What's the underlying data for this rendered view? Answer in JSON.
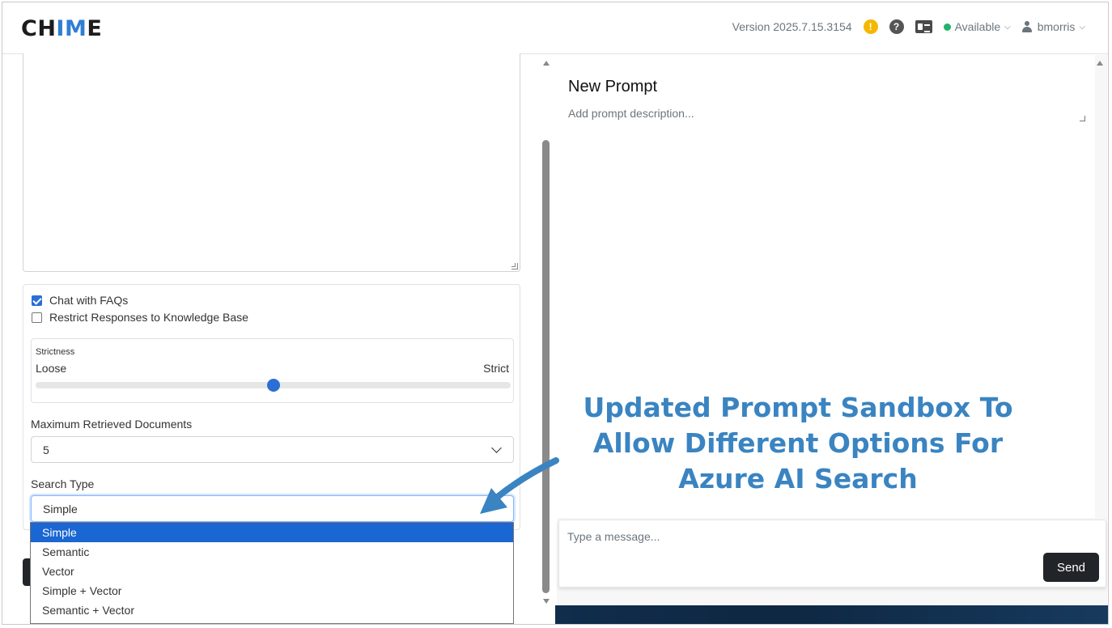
{
  "header": {
    "logo_prefix": "CH",
    "logo_highlight": "IM",
    "logo_suffix": "E",
    "version": "Version 2025.7.15.3154",
    "warning_icon": "!",
    "help_icon": "?",
    "status": "Available",
    "user": "bmorris"
  },
  "options": {
    "chat_faqs": {
      "label": "Chat with FAQs",
      "checked": true
    },
    "restrict": {
      "label": "Restrict Responses to Knowledge Base",
      "checked": false
    },
    "strictness": {
      "title": "Strictness",
      "min_label": "Loose",
      "max_label": "Strict",
      "value": 0.5
    },
    "max_docs": {
      "label": "Maximum Retrieved Documents",
      "value": "5"
    },
    "search_type": {
      "label": "Search Type",
      "value": "Simple",
      "options": [
        "Simple",
        "Semantic",
        "Vector",
        "Simple + Vector",
        "Semantic + Vector"
      ]
    }
  },
  "prompt": {
    "title": "New Prompt",
    "description_placeholder": "Add prompt description..."
  },
  "chat": {
    "placeholder": "Type a message...",
    "send_label": "Send"
  },
  "annotation": {
    "text": "Updated Prompt Sandbox To Allow Different Options For Azure AI Search",
    "color": "#3a84c1"
  }
}
